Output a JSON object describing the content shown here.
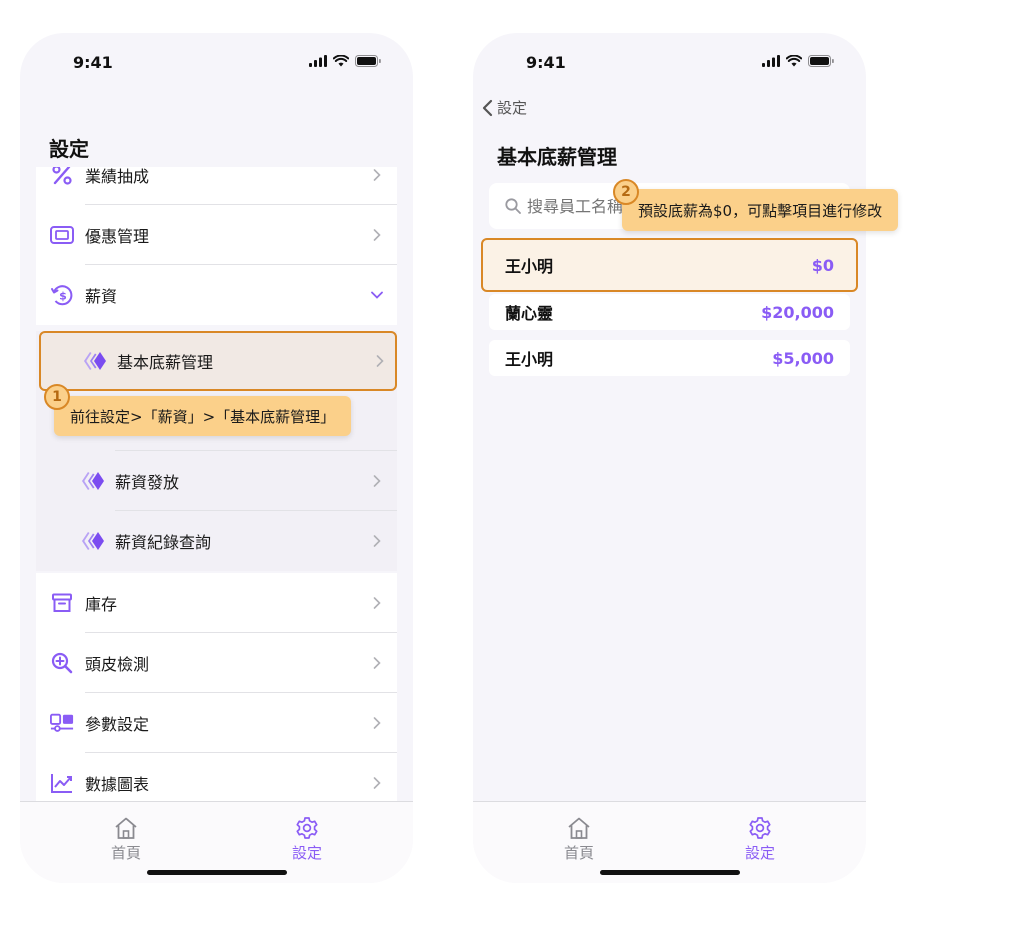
{
  "status": {
    "time": "9:41"
  },
  "screen1": {
    "title": "設定",
    "menu": [
      {
        "label": "業績抽成",
        "icon": "percent-icon"
      },
      {
        "label": "優惠管理",
        "icon": "ticket-icon"
      },
      {
        "label": "薪資",
        "icon": "salary-icon"
      }
    ],
    "sub_items": [
      {
        "label": "基本底薪管理"
      },
      {
        "label": "薪資發放"
      },
      {
        "label": "薪資紀錄查詢"
      }
    ],
    "menu_after": [
      {
        "label": "庫存",
        "icon": "archive-icon"
      },
      {
        "label": "頭皮檢測",
        "icon": "zoom-in-icon"
      },
      {
        "label": "參數設定",
        "icon": "parameters-icon"
      },
      {
        "label": "數據圖表",
        "icon": "chart-icon"
      }
    ],
    "callout": {
      "number": "1",
      "text": "前往設定>「薪資」>「基本底薪管理」"
    }
  },
  "screen2": {
    "back_label": "設定",
    "title": "基本底薪管理",
    "search_placeholder": "搜尋員工名稱",
    "employees": [
      {
        "name": "王小明",
        "salary": "$0"
      },
      {
        "name": "蘭心靈",
        "salary": "$20,000"
      },
      {
        "name": "王小明",
        "salary": "$5,000"
      }
    ],
    "callout": {
      "number": "2",
      "text": "預設底薪為$0，可點擊項目進行修改"
    }
  },
  "tabbar": {
    "home_label": "首頁",
    "settings_label": "設定"
  },
  "colors": {
    "accent": "#8a5cf5",
    "highlight_border": "#d98826",
    "callout_bg": "#fbd08a"
  }
}
